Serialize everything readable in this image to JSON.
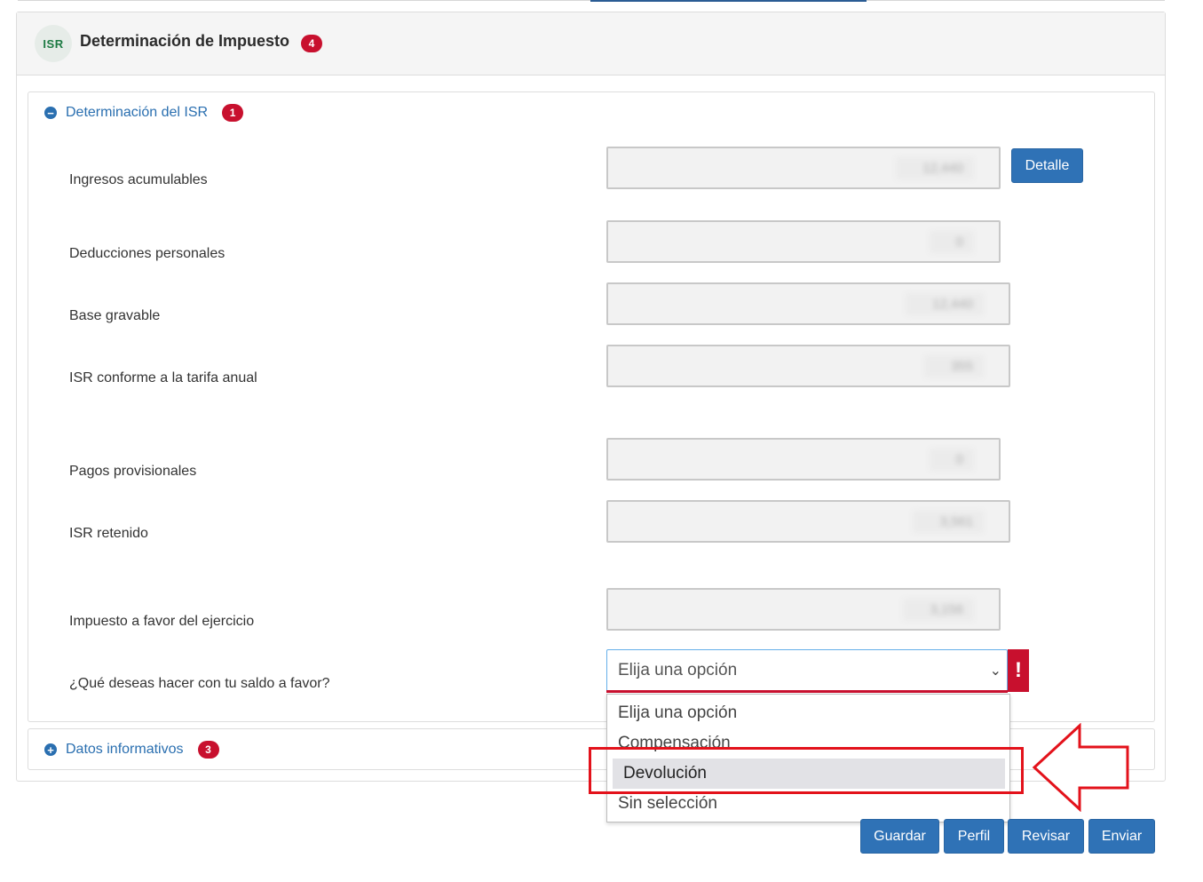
{
  "panel": {
    "icon_text": "ISR",
    "title": "Determinación de Impuesto",
    "badge": "4"
  },
  "section_isr": {
    "title": "Determinación del ISR",
    "badge": "1",
    "detail_button": "Detalle",
    "rows": [
      {
        "label": "Ingresos acumulables",
        "value": "12,440"
      },
      {
        "label": "Deducciones personales",
        "value": "0"
      },
      {
        "label": "Base gravable",
        "value": "12,440"
      },
      {
        "label": "ISR conforme a la tarifa anual",
        "value": "355"
      },
      {
        "label": "Pagos provisionales",
        "value": "0"
      },
      {
        "label": "ISR retenido",
        "value": "3,561"
      },
      {
        "label": "Impuesto a favor del ejercicio",
        "value": "3,156"
      }
    ],
    "question_label": "¿Qué deseas hacer con tu saldo a favor?",
    "select_value": "Elija una opción",
    "error_mark": "!",
    "options": [
      "Elija una opción",
      "Compensación",
      "Devolución",
      "Sin selección"
    ],
    "highlighted_option": "Devolución"
  },
  "section_info": {
    "title": "Datos informativos",
    "badge": "3"
  },
  "actions": {
    "guardar": "Guardar",
    "perfil": "Perfil",
    "revisar": "Revisar",
    "enviar": "Enviar"
  },
  "colors": {
    "accent_blue": "#2f72b6",
    "link_blue": "#2a6fb0",
    "badge_red": "#c8102e",
    "highlight_red": "#e3121b"
  }
}
